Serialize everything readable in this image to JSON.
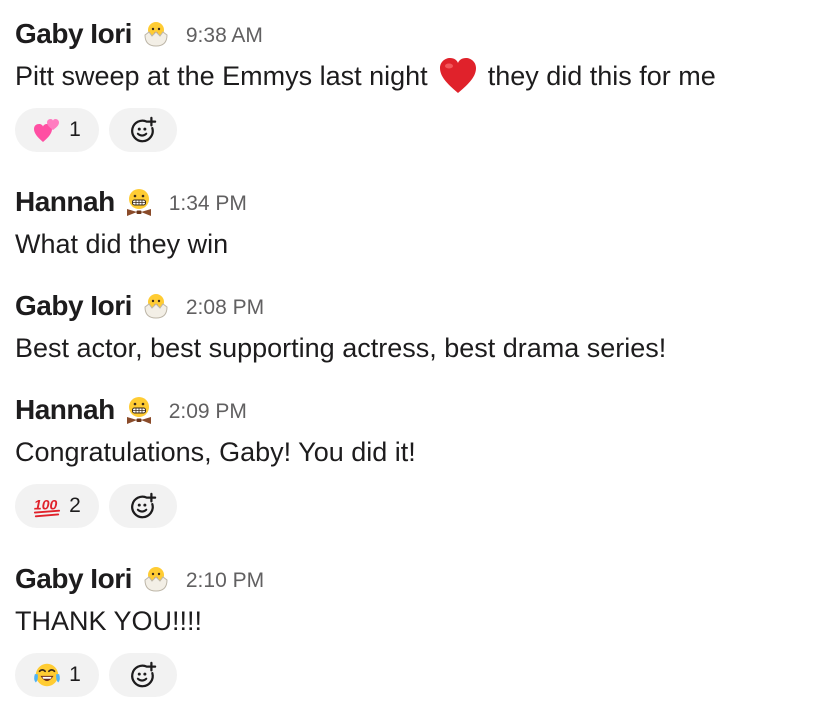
{
  "messages": [
    {
      "author": "Gaby Iori",
      "status_icon": "hatching-chick-icon",
      "time": "9:38 AM",
      "text_before": "Pitt sweep at the Emmys last night",
      "inline_icon": "red-heart-icon",
      "text_after": "they did this for me",
      "reactions": [
        {
          "icon": "two-hearts-icon",
          "count": "1"
        }
      ]
    },
    {
      "author": "Hannah",
      "status_icon": "grimacing-bowtie-icon",
      "time": "1:34 PM",
      "text": "What did they win"
    },
    {
      "author": "Gaby Iori",
      "status_icon": "hatching-chick-icon",
      "time": "2:08 PM",
      "text": "Best actor, best supporting actress, best drama series!"
    },
    {
      "author": "Hannah",
      "status_icon": "grimacing-bowtie-icon",
      "time": "2:09 PM",
      "text": "Congratulations, Gaby! You did it!",
      "reactions": [
        {
          "icon": "hundred-points-icon",
          "label": "100",
          "count": "2"
        }
      ]
    },
    {
      "author": "Gaby Iori",
      "status_icon": "hatching-chick-icon",
      "time": "2:10 PM",
      "text": "THANK YOU!!!!",
      "reactions": [
        {
          "icon": "tears-of-joy-icon",
          "count": "1"
        }
      ]
    }
  ],
  "colors": {
    "text": "#1d1c1d",
    "timestamp": "#616061",
    "pill_background": "#f2f2f2",
    "heart": "#e0222b",
    "hundred": "#e0222b"
  }
}
